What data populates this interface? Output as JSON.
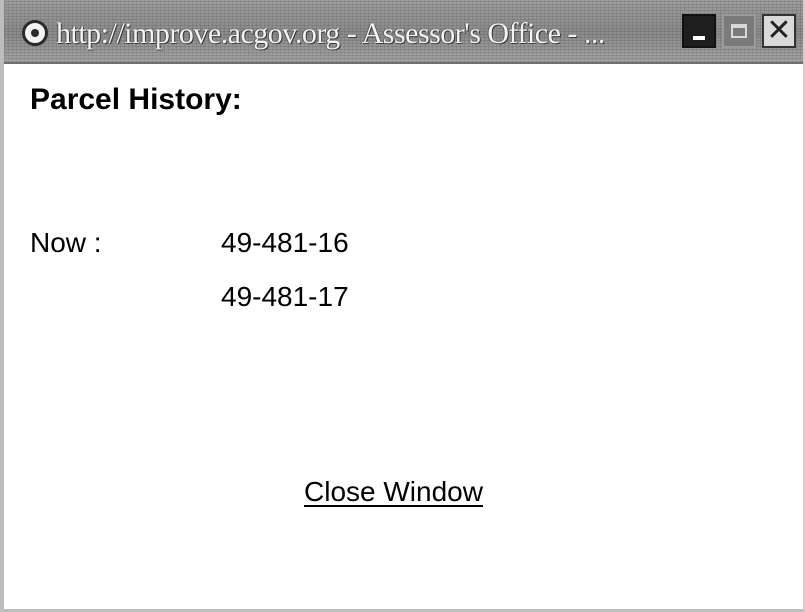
{
  "window": {
    "title": "http://improve.acgov.org - Assessor's Office - ..."
  },
  "page": {
    "heading": "Parcel History:",
    "now_label": "Now :",
    "parcels": [
      "49-481-16",
      "49-481-17"
    ],
    "close_link": "Close Window"
  },
  "icons": {
    "title_icon": "browser-page-icon",
    "minimize": "minimize-icon",
    "maximize": "maximize-icon",
    "close": "close-icon"
  },
  "colors": {
    "titlebar": "#8f8f8f",
    "background": "#ffffff",
    "text": "#000000"
  }
}
